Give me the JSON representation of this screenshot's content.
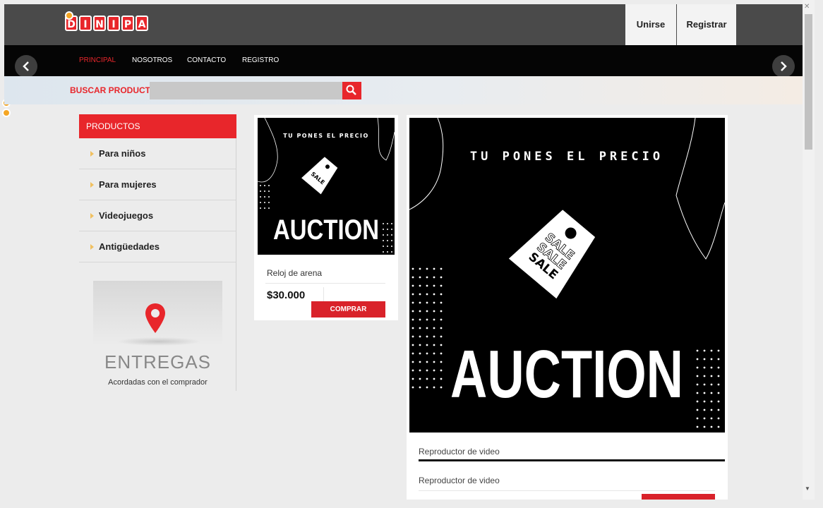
{
  "header": {
    "logo_letters": [
      "D",
      "I",
      "N",
      "I",
      "P",
      "A"
    ],
    "join_label": "Unirse",
    "register_label": "Registrar"
  },
  "nav": {
    "items": [
      {
        "label": "PRINCIPAL",
        "active": true
      },
      {
        "label": "NOSOTROS",
        "active": false
      },
      {
        "label": "CONTACTO",
        "active": false
      },
      {
        "label": "REGISTRO",
        "active": false
      }
    ],
    "prev_icon": "chevron-left-icon",
    "next_icon": "chevron-right-icon"
  },
  "search": {
    "label": "BUSCAR PRODUCTO",
    "value": "",
    "placeholder": "",
    "button_icon": "search-icon"
  },
  "sidebar": {
    "heading": "PRODUCTOS",
    "items": [
      {
        "label": "Para niños"
      },
      {
        "label": "Para mujeres"
      },
      {
        "label": "Videojuegos"
      },
      {
        "label": "Antigüedades"
      }
    ],
    "delivery": {
      "title": "ENTREGAS",
      "subtitle": "Acordadas con el comprador",
      "icon": "map-pin-icon"
    }
  },
  "product": {
    "image_heading": "TU PONES EL PRECIO",
    "image_title": "AUCTION",
    "image_tag": "SALE",
    "name": "Reloj de arena",
    "price": "$30.000",
    "buy_label": "COMPRAR"
  },
  "featured": {
    "image_heading": "TU PONES EL PRECIO",
    "image_title": "AUCTION",
    "image_tag": "SALE",
    "video_title_1": "Reproductor de video",
    "video_title_2": "Reproductor de video"
  },
  "colors": {
    "accent": "#e8262b",
    "header_bg": "#4a4a4a",
    "nav_bg": "#050505",
    "page_bg": "#ececec"
  }
}
